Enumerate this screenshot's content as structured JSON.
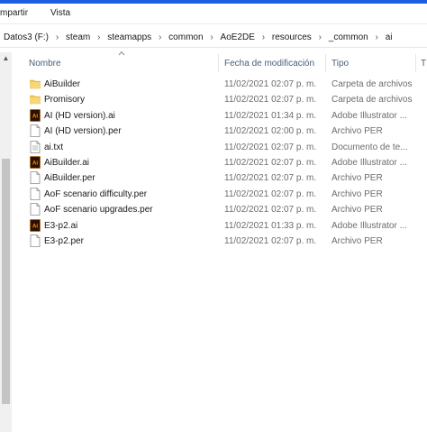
{
  "ribbon": {
    "tabs": [
      "mpartir",
      "Vista"
    ]
  },
  "breadcrumb": [
    "Datos3 (F:)",
    "steam",
    "steamapps",
    "common",
    "AoE2DE",
    "resources",
    "_common",
    "ai"
  ],
  "columns": {
    "name": "Nombre",
    "date": "Fecha de modificación",
    "type": "Tipo",
    "size": "T"
  },
  "files": [
    {
      "name": "AiBuilder",
      "date": "11/02/2021 02:07 p. m.",
      "type": "Carpeta de archivos",
      "icon": "folder-icon"
    },
    {
      "name": "Promisory",
      "date": "11/02/2021 02:07 p. m.",
      "type": "Carpeta de archivos",
      "icon": "folder-icon"
    },
    {
      "name": "AI (HD version).ai",
      "date": "11/02/2021 01:34 p. m.",
      "type": "Adobe Illustrator ...",
      "icon": "illustrator-icon"
    },
    {
      "name": "AI (HD version).per",
      "date": "11/02/2021 02:00 p. m.",
      "type": "Archivo PER",
      "icon": "document-icon"
    },
    {
      "name": "ai.txt",
      "date": "11/02/2021 02:07 p. m.",
      "type": "Documento de te...",
      "icon": "text-file-icon"
    },
    {
      "name": "AiBuilder.ai",
      "date": "11/02/2021 02:07 p. m.",
      "type": "Adobe Illustrator ...",
      "icon": "illustrator-icon"
    },
    {
      "name": "AiBuilder.per",
      "date": "11/02/2021 02:07 p. m.",
      "type": "Archivo PER",
      "icon": "document-icon"
    },
    {
      "name": "AoF scenario difficulty.per",
      "date": "11/02/2021 02:07 p. m.",
      "type": "Archivo PER",
      "icon": "document-icon"
    },
    {
      "name": "AoF scenario upgrades.per",
      "date": "11/02/2021 02:07 p. m.",
      "type": "Archivo PER",
      "icon": "document-icon"
    },
    {
      "name": "E3-p2.ai",
      "date": "11/02/2021 01:33 p. m.",
      "type": "Adobe Illustrator ...",
      "icon": "illustrator-icon"
    },
    {
      "name": "E3-p2.per",
      "date": "11/02/2021 02:07 p. m.",
      "type": "Archivo PER",
      "icon": "document-icon"
    }
  ],
  "colors": {
    "accent": "#1d5fe0",
    "folder": "#f2c94c",
    "illustrator": "#2e0f00",
    "illustrator_text": "#ff9a00"
  }
}
